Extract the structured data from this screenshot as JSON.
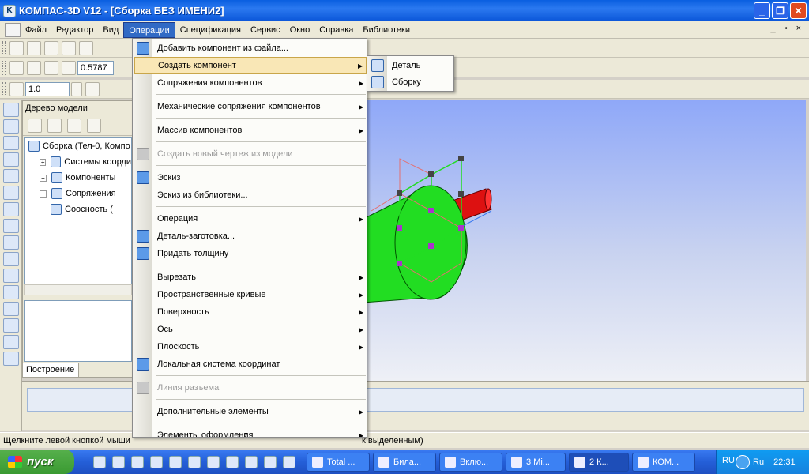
{
  "window": {
    "title": "КОМПАС-3D V12 - [Сборка БЕЗ ИМЕНИ2]",
    "app_icon": "kompas-logo-icon",
    "controls": [
      "minimize",
      "restore",
      "close"
    ]
  },
  "menubar": {
    "items": [
      "Файл",
      "Редактор",
      "Вид",
      "Операции",
      "Спецификация",
      "Сервис",
      "Окно",
      "Справка",
      "Библиотеки"
    ],
    "active_index": 3,
    "right_controls": "_ ▫ ×"
  },
  "toolbar": {
    "zoom_value": "0.5787",
    "step_value": "1.0"
  },
  "tree": {
    "title": "Дерево модели",
    "rows": [
      {
        "label": "Сборка (Тел-0, Компо",
        "level": 0,
        "expander": ""
      },
      {
        "label": "Системы коорди",
        "level": 1,
        "expander": "+"
      },
      {
        "label": "Компоненты",
        "level": 1,
        "expander": "+"
      },
      {
        "label": "Сопряжения",
        "level": 1,
        "expander": "−"
      },
      {
        "label": "Соосность (",
        "level": 2,
        "expander": ""
      }
    ],
    "build_tab": "Построение"
  },
  "operations_menu": {
    "items": [
      {
        "label": "Добавить компонент из файла...",
        "submenu": false,
        "disabled": false,
        "icon": "add-component-icon"
      },
      {
        "label": "Создать компонент",
        "submenu": true,
        "disabled": false,
        "highlight": true,
        "icon": ""
      },
      {
        "label": "Сопряжения компонентов",
        "submenu": true,
        "disabled": false,
        "icon": ""
      },
      {
        "label": "Механические сопряжения компонентов",
        "submenu": true,
        "disabled": false,
        "icon": ""
      },
      {
        "label": "Массив компонентов",
        "submenu": true,
        "disabled": false,
        "icon": ""
      },
      {
        "label": "Создать новый чертеж из модели",
        "submenu": false,
        "disabled": true,
        "icon": "drawing-icon"
      },
      {
        "label": "Эскиз",
        "submenu": false,
        "disabled": false,
        "icon": "sketch-icon"
      },
      {
        "label": "Эскиз из библиотеки...",
        "submenu": false,
        "disabled": false,
        "icon": ""
      },
      {
        "label": "Операция",
        "submenu": true,
        "disabled": false,
        "icon": ""
      },
      {
        "label": "Деталь-заготовка...",
        "submenu": false,
        "disabled": false,
        "icon": "blank-part-icon"
      },
      {
        "label": "Придать толщину",
        "submenu": false,
        "disabled": false,
        "icon": "thicken-icon"
      },
      {
        "label": "Вырезать",
        "submenu": true,
        "disabled": false,
        "icon": ""
      },
      {
        "label": "Пространственные кривые",
        "submenu": true,
        "disabled": false,
        "icon": ""
      },
      {
        "label": "Поверхность",
        "submenu": true,
        "disabled": false,
        "icon": ""
      },
      {
        "label": "Ось",
        "submenu": true,
        "disabled": false,
        "icon": ""
      },
      {
        "label": "Плоскость",
        "submenu": true,
        "disabled": false,
        "icon": ""
      },
      {
        "label": "Локальная система координат",
        "submenu": false,
        "disabled": false,
        "icon": "local-cs-icon"
      },
      {
        "label": "Линия разъема",
        "submenu": false,
        "disabled": true,
        "icon": "parting-line-icon"
      },
      {
        "label": "Дополнительные элементы",
        "submenu": true,
        "disabled": false,
        "icon": ""
      },
      {
        "label": "Элементы оформления",
        "submenu": true,
        "disabled": false,
        "icon": ""
      }
    ]
  },
  "create_component_submenu": {
    "items": [
      "Деталь",
      "Сборку"
    ]
  },
  "statusbar": {
    "left_text": "Щелкните левой кнопкой мыши",
    "right_text": "к выделенным)"
  },
  "taskbar": {
    "start_label": "пуск",
    "tasks": [
      "Total ...",
      "Била...",
      "Вклю...",
      "3 Mi...",
      "2 К...",
      "КОМ..."
    ],
    "active_task_index": 4,
    "lang": "RU",
    "tray_lang": "Ru",
    "clock": "22:31"
  },
  "colors": {
    "title_blue": "#0a5fe0",
    "menu_highlight": "#f9e7b6",
    "part_green": "#22dd22",
    "shaft_red": "#dd1111"
  }
}
